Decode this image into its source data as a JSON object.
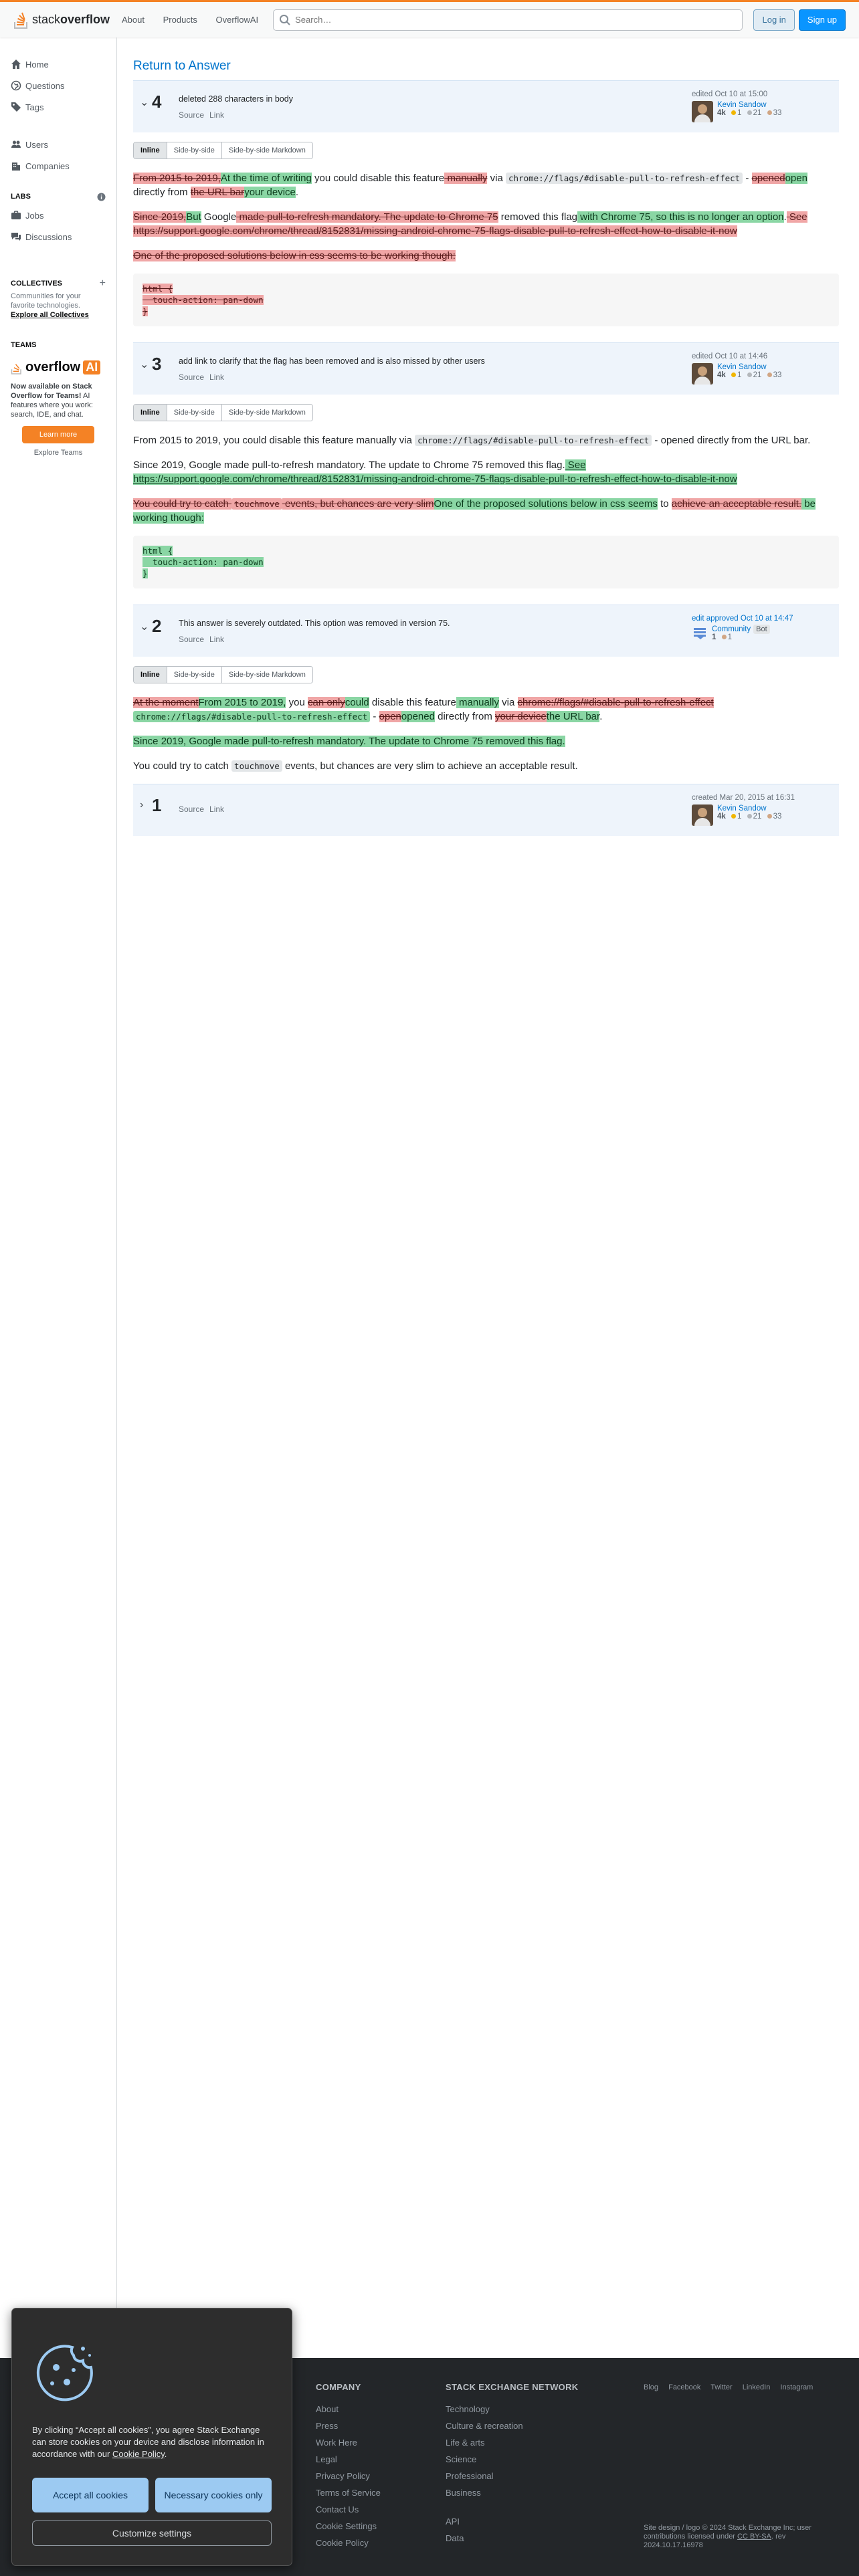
{
  "header": {
    "logo_text_1": "stack",
    "logo_text_2": "overflow",
    "nav": [
      "About",
      "Products",
      "OverflowAI"
    ],
    "search_placeholder": "Search…",
    "login": "Log in",
    "signup": "Sign up"
  },
  "sidebar": {
    "home": "Home",
    "questions": "Questions",
    "tags": "Tags",
    "users": "Users",
    "companies": "Companies",
    "labs_head": "LABS",
    "jobs": "Jobs",
    "discussions": "Discussions",
    "collectives_head": "COLLECTIVES",
    "collectives_note": "Communities for your favorite technologies.",
    "explore_collectives": "Explore all Collectives",
    "teams_head": "TEAMS",
    "oai_word": "overflow",
    "oai_badge": "AI",
    "teams_bold": "Now available on Stack Overflow for Teams!",
    "teams_text": " AI features where you work: search, IDE, and chat.",
    "learn_more": "Learn more",
    "explore_teams": "Explore Teams"
  },
  "main": {
    "return_link": "Return to Answer",
    "tabs": [
      "Inline",
      "Side-by-side",
      "Side-by-side Markdown"
    ],
    "source": "Source",
    "link": "Link"
  },
  "revisions": [
    {
      "num": "4",
      "comment": "deleted 288 characters in body",
      "action": "edited Oct 10 at 15:00",
      "user": "Kevin Sandow",
      "rep": "4k",
      "gold": "1",
      "silver": "21",
      "bronze": "33"
    },
    {
      "num": "3",
      "comment": "add link to clarify that the flag has been removed and is also missed by other users",
      "action": "edited Oct 10 at 14:46",
      "user": "Kevin Sandow",
      "rep": "4k",
      "gold": "1",
      "silver": "21",
      "bronze": "33"
    },
    {
      "num": "2",
      "comment": "This answer is severely outdated. This option was removed in version 75.",
      "action": "edit approved Oct 10 at 14:47",
      "user": "Community",
      "bot": "Bot",
      "rep": "1",
      "bronze": "1"
    },
    {
      "num": "1",
      "comment": "",
      "action": "created Mar 20, 2015 at 16:31",
      "user": "Kevin Sandow",
      "rep": "4k",
      "gold": "1",
      "silver": "21",
      "bronze": "33"
    }
  ],
  "r4": {
    "p1_del1": "From 2015 to 2019,",
    "p1_ins1": "At the time of writing",
    "p1_t1": " you could disable this feature",
    "p1_del2": " manually",
    "p1_t2": " via ",
    "code": "chrome://flags/#disable-pull-to-refresh-effect",
    "p1_t3": " - ",
    "p1_del3": "opened",
    "p1_ins3": "open",
    "p1_t4": " directly from ",
    "p1_del4": "the URL bar",
    "p1_ins4": "your device",
    "p1_t5": ".",
    "p2_del1": "Since 2019,",
    "p2_ins1": "But",
    "p2_t1": " Google",
    "p2_del2": " made pull-to-refresh mandatory. The update to Chrome 75",
    "p2_t2": " removed this flag",
    "p2_ins2": " with Chrome 75, so this is no longer an option",
    "p2_t3": ".",
    "p2_del3": " See https://support.google.com/chrome/thread/8152831/missing-android-chrome-75-flags-disable-pull-to-refresh-effect-how-to-disable-it-now",
    "p3_del": "One of the proposed solutions below in css seems to be working though:",
    "pre": [
      "html {",
      "  touch-action: pan-down",
      "}"
    ]
  },
  "r3": {
    "p1": "From 2015 to 2019, you could disable this feature manually via ",
    "code": "chrome://flags/#disable-pull-to-refresh-effect",
    "p1_end": " - opened directly from the URL bar.",
    "p2": "Since 2019, Google made pull-to-refresh mandatory. The update to Chrome 75 removed this flag.",
    "p2_ins": " See https://support.google.com/chrome/thread/8152831/missing-android-chrome-75-flags-disable-pull-to-refresh-effect-how-to-disable-it-now",
    "p3_del1": "You could try to catch ",
    "p3_code": "touchmove",
    "p3_del2": " events, but chances are very slim",
    "p3_ins1": "One of the proposed solutions below in css seems",
    "p3_t1": " to ",
    "p3_del3": "achieve an acceptable result.",
    "p3_ins2": " be working though:",
    "pre": [
      "html {",
      "  touch-action: pan-down",
      "}"
    ]
  },
  "r2": {
    "p1_del1": "At the moment",
    "p1_ins1": "From 2015 to 2019,",
    "p1_t1": " you ",
    "p1_del2": "can only",
    "p1_ins2": "could",
    "p1_t2": " disable this feature",
    "p1_ins3": " manually",
    "p1_t3": " via ",
    "p1_del3": "chrome://flags/#disable-pull-to-refresh-effect",
    "p1_ins4_code": "chrome://flags/#disable-pull-to-refresh-effect",
    "p1_t4": " - ",
    "p1_del5": "open",
    "p1_ins5": "opened",
    "p1_t5": " directly from ",
    "p1_del6": "your device",
    "p1_ins6": "the URL bar",
    "p1_t6": ".",
    "p2_ins": "Since 2019, Google made pull-to-refresh mandatory. The update to Chrome 75 removed this flag.",
    "p3_t1": "You could try to catch ",
    "p3_code": "touchmove",
    "p3_t2": " events, but chances are very slim to achieve an acceptable result."
  },
  "footer": {
    "company_head": "COMPANY",
    "company": [
      "About",
      "Press",
      "Work Here",
      "Legal",
      "Privacy Policy",
      "Terms of Service",
      "Contact Us",
      "Cookie Settings",
      "Cookie Policy"
    ],
    "network_head": "STACK EXCHANGE NETWORK",
    "network": [
      "Technology",
      "Culture & recreation",
      "Life & arts",
      "Science",
      "Professional",
      "Business"
    ],
    "network2": [
      "API",
      "Data"
    ],
    "social": [
      "Blog",
      "Facebook",
      "Twitter",
      "LinkedIn",
      "Instagram"
    ],
    "copy1": "Site design / logo © 2024 Stack Exchange Inc; user contributions licensed under ",
    "license": "CC BY-SA",
    "copy2": ". rev 2024.10.17.16978"
  },
  "cookie": {
    "text": "By clicking “Accept all cookies”, you agree Stack Exchange can store cookies on your device and disclose information in accordance with our ",
    "policy_link": "Cookie Policy",
    "period": ".",
    "accept": "Accept all cookies",
    "necessary": "Necessary cookies only",
    "customize": "Customize settings"
  }
}
